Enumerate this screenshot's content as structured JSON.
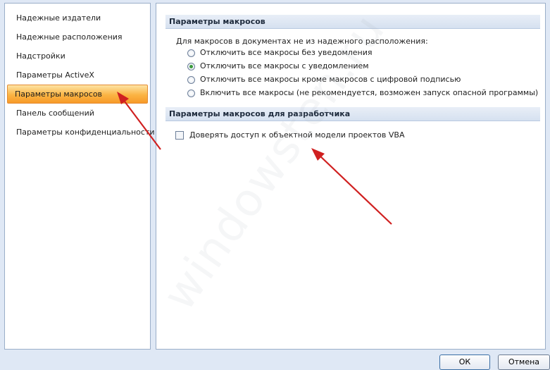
{
  "sidebar": {
    "items": [
      {
        "label": "Надежные издатели",
        "selected": false
      },
      {
        "label": "Надежные расположения",
        "selected": false
      },
      {
        "label": "Надстройки",
        "selected": false
      },
      {
        "label": "Параметры ActiveX",
        "selected": false
      },
      {
        "label": "Параметры макросов",
        "selected": true
      },
      {
        "label": "Панель сообщений",
        "selected": false
      },
      {
        "label": "Параметры конфиденциальности",
        "selected": false
      }
    ]
  },
  "macro_settings": {
    "header": "Параметры макросов",
    "intro": "Для макросов в документах не из надежного расположения:",
    "options": [
      {
        "label": "Отключить все макросы без уведомления",
        "checked": false
      },
      {
        "label": "Отключить все макросы с уведомлением",
        "checked": true
      },
      {
        "label": "Отключить все макросы кроме макросов с цифровой подписью",
        "checked": false
      },
      {
        "label": "Включить все макросы (не рекомендуется, возможен запуск опасной программы)",
        "checked": false
      }
    ]
  },
  "developer_settings": {
    "header": "Параметры макросов для разработчика",
    "vba_trust_label": "Доверять доступ к объектной модели проектов VBA",
    "vba_trust_checked": false
  },
  "buttons": {
    "ok_label": "ОК",
    "cancel_label": "Отмена"
  },
  "watermark": "windowsten.ru",
  "colors": {
    "window_bg": "#dfe8f5",
    "selection_orange": "#fbb443",
    "arrow_red": "#d02020",
    "radio_green": "#3b9a3d"
  }
}
